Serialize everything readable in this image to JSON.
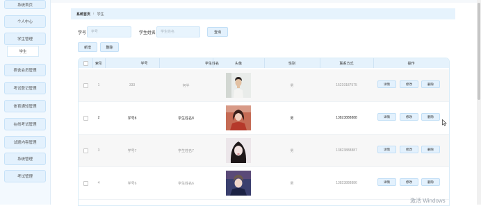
{
  "sidebar": {
    "items": [
      {
        "label": "系统首页"
      },
      {
        "label": "个人中心"
      },
      {
        "label": "学生管理"
      },
      {
        "label": "宿舍会员管理"
      },
      {
        "label": "考试登记管理"
      },
      {
        "label": "体育通知管理"
      },
      {
        "label": "在线考试管理"
      },
      {
        "label": "试题内容管理"
      },
      {
        "label": "系统管理"
      },
      {
        "label": "考试管理"
      }
    ],
    "sub_item": {
      "label": "学生"
    }
  },
  "breadcrumb": {
    "home": "系统首页",
    "separator": "⁝",
    "current": "学生"
  },
  "search": {
    "student_no_label": "学号",
    "student_no_placeholder": "学号",
    "student_name_label": "学生姓名",
    "student_name_placeholder": "学生姓名",
    "query_button": "查询"
  },
  "toolbar": {
    "add_label": "新增",
    "delete_label": "删除"
  },
  "table": {
    "headers": [
      "",
      "索引",
      "学号",
      "学生姓名",
      "头像",
      "性别",
      "联系方式",
      "操作"
    ],
    "rows": [
      {
        "index": "1",
        "student_no": "333",
        "name": "何半",
        "gender": "男",
        "phone": "15219187575",
        "avatar": "male-student-photo"
      },
      {
        "index": "2",
        "student_no": "学号8",
        "name": "学生姓名8",
        "gender": "男",
        "phone": "13823888888",
        "avatar": "female-student-photo"
      },
      {
        "index": "3",
        "student_no": "学号7",
        "name": "学生姓名7",
        "gender": "男",
        "phone": "13823888887",
        "avatar": "female-student-photo"
      },
      {
        "index": "4",
        "student_no": "学号6",
        "name": "学生姓名6",
        "gender": "男",
        "phone": "13823888886",
        "avatar": "male-student-photo"
      }
    ],
    "action_labels": {
      "detail": "详情",
      "edit": "修改",
      "delete": "删除"
    }
  },
  "watermark": "激活 Windows",
  "colors": {
    "accent_bg": "#e3f1fd",
    "accent_border": "#c2dff6",
    "sidebar_bg": "#f3f9fe"
  }
}
